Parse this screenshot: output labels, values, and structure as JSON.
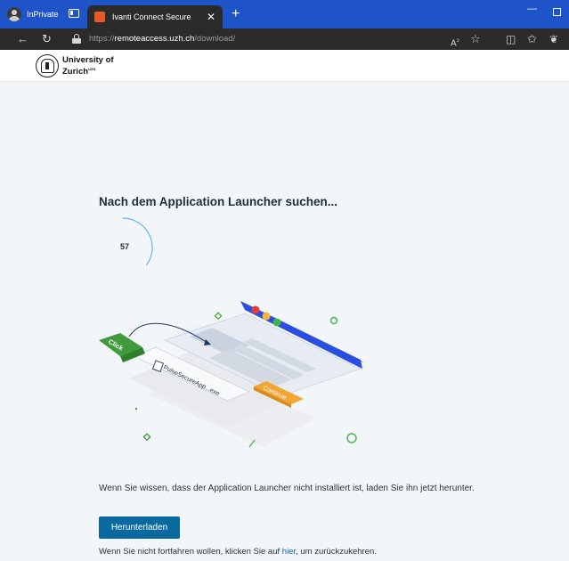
{
  "browser": {
    "inprivate_label": "InPrivate",
    "tab_title": "Ivanti Connect Secure",
    "tab_close": "✕",
    "new_tab": "+",
    "url": {
      "scheme": "https://",
      "host": "remoteaccess.uzh.ch",
      "path": "/download/"
    },
    "icons": [
      "back-icon",
      "refresh-icon",
      "lock-icon",
      "read-aloud-icon",
      "favorite-icon",
      "split-screen-icon",
      "favorites-icon",
      "extensions-icon"
    ]
  },
  "header": {
    "logo_line1": "University of",
    "logo_line2": "Zurich",
    "logo_sup": "UZH"
  },
  "main": {
    "heading": "Nach dem Application Launcher suchen...",
    "countdown": "57",
    "countdown_progress": 0.35,
    "illustration": {
      "click_label": "Click",
      "file_label": "PulseSecureApp...exe",
      "continue_label": "Continue"
    },
    "info_text": "Wenn Sie wissen, dass der Application Launcher nicht installiert ist, laden Sie ihn jetzt herunter.",
    "download_button": "Herunterladen",
    "back_prefix": "Wenn Sie nicht fortfahren wollen, klicken Sie auf",
    "back_link": "hier",
    "back_suffix": ", um zurückzukehren."
  },
  "colors": {
    "titlebar": "#1e54c8",
    "accent": "#0a6aa0",
    "illustration_blue": "#2a4ee0",
    "click_green": "#3e9a3a",
    "continue_orange": "#f2a531"
  }
}
